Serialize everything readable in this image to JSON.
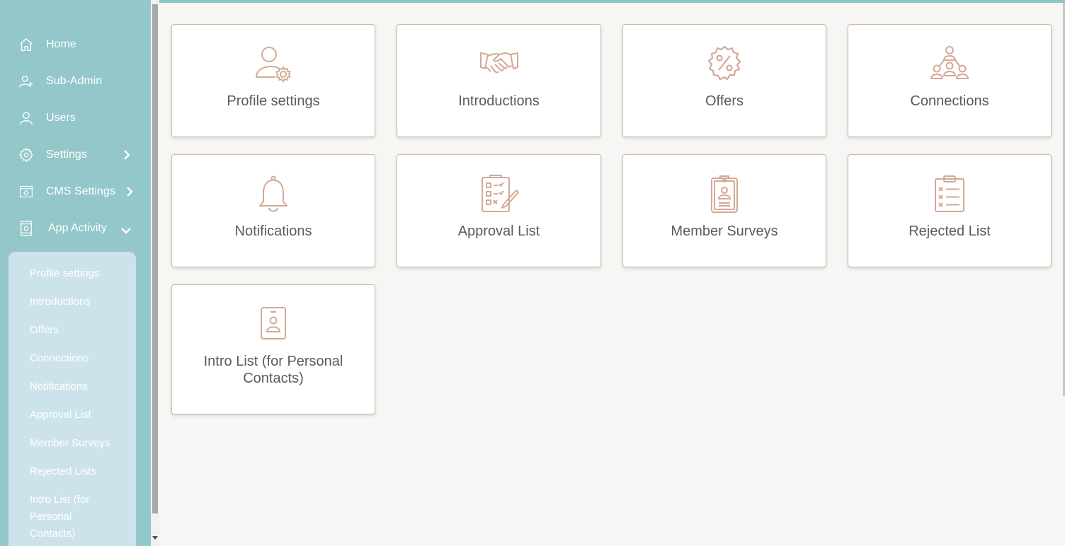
{
  "sidebar": {
    "items": [
      {
        "label": "Home",
        "icon": "home-icon"
      },
      {
        "label": "Sub-Admin",
        "icon": "user-plus-icon"
      },
      {
        "label": "Users",
        "icon": "user-icon"
      },
      {
        "label": "Settings",
        "icon": "gear-icon"
      },
      {
        "label": "CMS Settings",
        "icon": "cms-settings-icon"
      },
      {
        "label": "App Activity",
        "icon": "app-activity-icon"
      }
    ],
    "submenu": [
      "Profile settings",
      "Introductions",
      "Offers",
      "Connections",
      "Notifications",
      "Approval List",
      "Member Surveys",
      "Rejected Lists",
      "Intro List (for Personal Contacts)"
    ]
  },
  "cards": [
    {
      "label": "Profile settings",
      "icon": "user-gear-icon"
    },
    {
      "label": "Introductions",
      "icon": "handshake-icon"
    },
    {
      "label": "Offers",
      "icon": "discount-badge-icon"
    },
    {
      "label": "Connections",
      "icon": "network-icon"
    },
    {
      "label": "Notifications",
      "icon": "bell-icon"
    },
    {
      "label": "Approval List",
      "icon": "checklist-pen-icon"
    },
    {
      "label": "Member Surveys",
      "icon": "clipboard-person-icon"
    },
    {
      "label": "Rejected List",
      "icon": "clipboard-x-list-icon"
    },
    {
      "label": "Intro List (for Personal Contacts)",
      "icon": "id-badge-icon"
    }
  ],
  "colors": {
    "sidebar_bg": "#94c7c9",
    "submenu_bg": "#cde3eb",
    "card_border": "#d8b3a4",
    "icon_accent": "#d3a996",
    "page_bg": "#f6f6f4"
  }
}
